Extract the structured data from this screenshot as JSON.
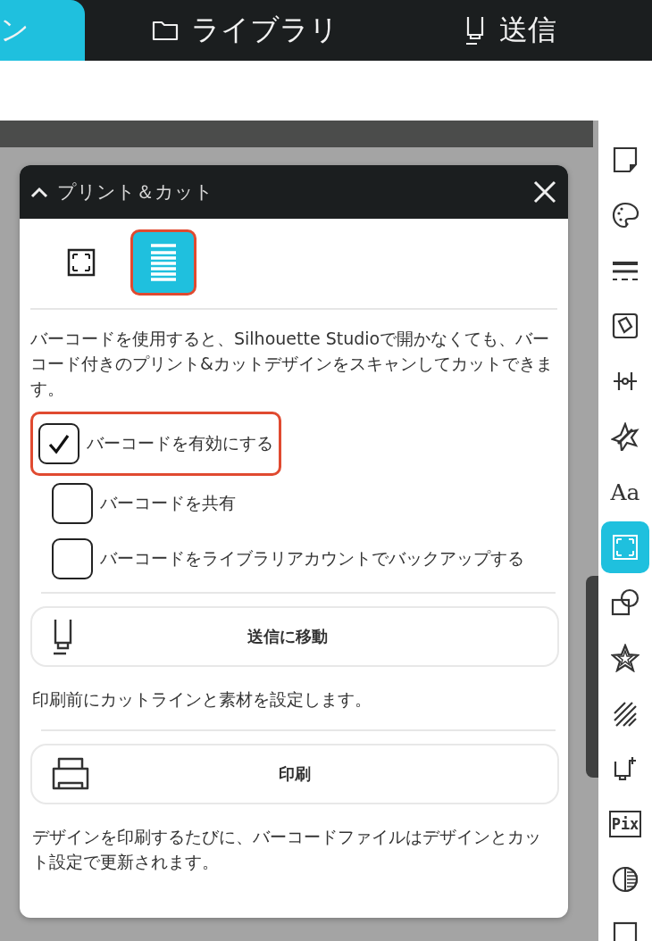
{
  "top_tabs": [
    {
      "label": "ン",
      "kind": "none",
      "selected": true
    },
    {
      "label": "ライブラリ",
      "kind": "folder",
      "selected": false
    },
    {
      "label": "送信",
      "kind": "send",
      "selected": false
    }
  ],
  "panel": {
    "title": "プリント＆カット",
    "modes": [
      {
        "kind": "registration",
        "selected": false,
        "highlighted": false
      },
      {
        "kind": "barcode",
        "selected": true,
        "highlighted": true
      }
    ],
    "description": "バーコードを使用すると、Silhouette Studioで開かなくても、バーコード付きのプリント&カットデザインをスキャンしてカットできます。",
    "options": [
      {
        "label": "バーコードを有効にする",
        "checked": true,
        "highlighted": true
      },
      {
        "label": "バーコードを共有",
        "checked": false,
        "highlighted": false
      },
      {
        "label": "バーコードをライブラリアカウントでバックアップする",
        "checked": false,
        "highlighted": false
      }
    ],
    "actions": [
      {
        "kind": "send",
        "label": "送信に移動",
        "note": "印刷前にカットラインと素材を設定します。"
      },
      {
        "kind": "print",
        "label": "印刷",
        "note": "デザインを印刷するたびに、バーコードファイルはデザインとカット設定で更新されます。"
      }
    ]
  },
  "tools": [
    {
      "kind": "page",
      "selected": false
    },
    {
      "kind": "palette",
      "selected": false
    },
    {
      "kind": "lines",
      "selected": false
    },
    {
      "kind": "fill",
      "selected": false
    },
    {
      "kind": "align",
      "selected": false
    },
    {
      "kind": "replicate",
      "selected": false
    },
    {
      "kind": "text",
      "label": "Aa",
      "selected": false
    },
    {
      "kind": "printcut",
      "selected": true
    },
    {
      "kind": "shapes",
      "selected": false
    },
    {
      "kind": "star",
      "selected": false
    },
    {
      "kind": "sketch",
      "selected": false
    },
    {
      "kind": "sendplus",
      "selected": false
    },
    {
      "kind": "pix",
      "label": "Pix",
      "selected": false
    },
    {
      "kind": "contrast",
      "selected": false
    },
    {
      "kind": "box",
      "selected": false
    }
  ]
}
